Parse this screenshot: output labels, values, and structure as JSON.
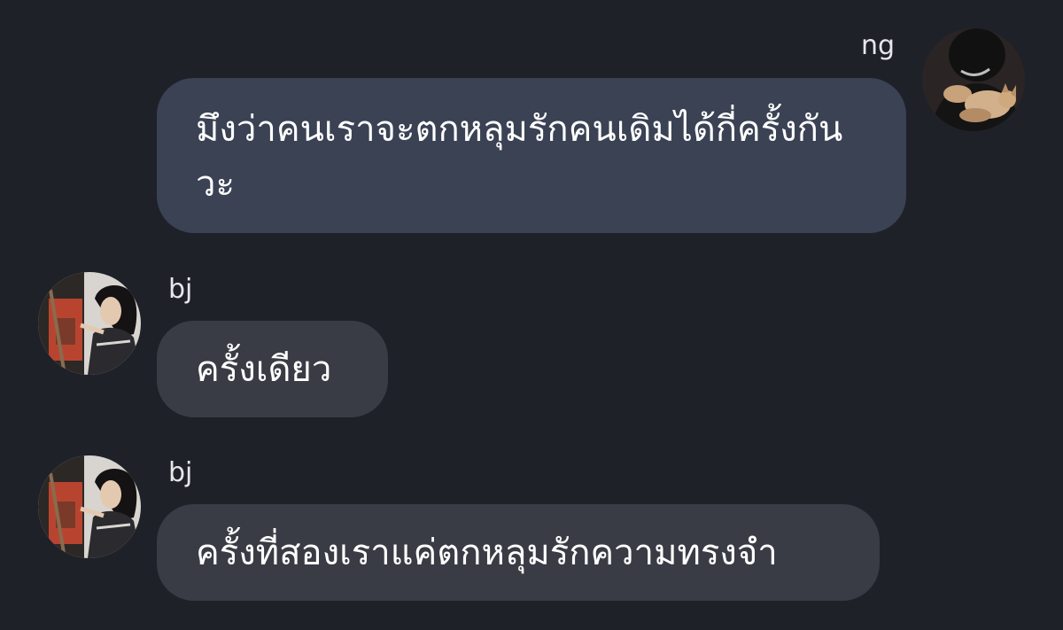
{
  "messages": [
    {
      "sender": "ng",
      "direction": "outgoing",
      "avatar": "avatar-ng",
      "text": "มึงว่าคนเราจะตกหลุมรักคนเดิมได้กี่ครั้งกันวะ"
    },
    {
      "sender": "bj",
      "direction": "incoming",
      "avatar": "avatar-bj",
      "text": "ครั้งเดียว"
    },
    {
      "sender": "bj",
      "direction": "incoming",
      "avatar": "avatar-bj",
      "text": "ครั้งที่สองเราแค่ตกหลุมรักความทรงจำ"
    }
  ],
  "colors": {
    "background": "#1f2129",
    "outgoing_bubble": "#3a4254",
    "incoming_bubble": "#3a3c45",
    "text": "#ffffff"
  }
}
